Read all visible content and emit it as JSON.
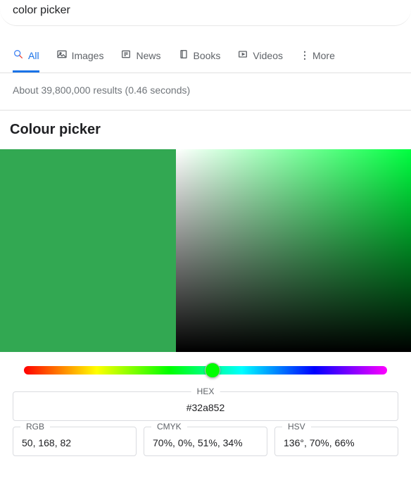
{
  "search": {
    "query": "color picker"
  },
  "tabs": {
    "all": "All",
    "images": "Images",
    "news": "News",
    "books": "Books",
    "videos": "Videos",
    "more": "More"
  },
  "result_stats": "About 39,800,000 results (0.46 seconds)",
  "widget": {
    "title": "Colour picker",
    "swatch_color": "#32a852",
    "hue_handle_pct": "52%",
    "hue_handle_color": "#0f0",
    "satval_hue_color": "#00ff40",
    "hex": {
      "label": "HEX",
      "value": "#32a852"
    },
    "rgb": {
      "label": "RGB",
      "value": "50, 168, 82"
    },
    "cmyk": {
      "label": "CMYK",
      "value": "70%, 0%, 51%, 34%"
    },
    "hsv": {
      "label": "HSV",
      "value": "136°, 70%, 66%"
    }
  }
}
